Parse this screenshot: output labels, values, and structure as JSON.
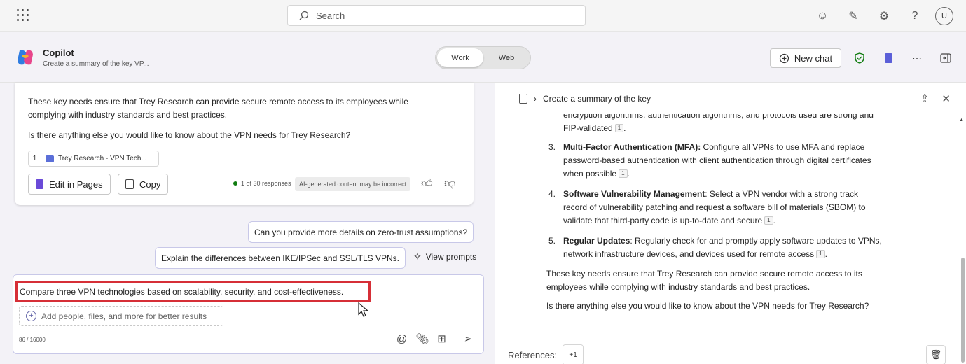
{
  "topbar": {
    "search_placeholder": "Search",
    "avatar_initial": "U"
  },
  "app": {
    "title": "Copilot",
    "subtitle": "Create a summary of the key VP...",
    "mode_work": "Work",
    "mode_web": "Web",
    "new_chat": "New chat"
  },
  "chat": {
    "answer_p1": "These key needs ensure that Trey Research can provide secure remote access to its employees while",
    "answer_p1b": "complying with industry standards and best practices.",
    "answer_p2": "Is there anything else you would like to know about the VPN needs for Trey Research?",
    "citation_num": "1",
    "citation_label": "Trey Research - VPN Tech...",
    "edit_in_pages": "Edit in Pages",
    "copy": "Copy",
    "responses": "1 of 30 responses",
    "ai_disclaimer": "AI-generated content may be incorrect",
    "suggestion_1": "Can you provide more details on zero-trust assumptions?",
    "suggestion_2": "Explain the differences between IKE/IPSec and SSL/TLS VPNs.",
    "view_prompts": "View prompts",
    "input_text": "Compare three VPN technologies based on scalability, security, and cost-effectiveness.",
    "add_placeholder": "Add people, files, and more for better results",
    "char_count": "86 / 16000"
  },
  "pane": {
    "title": "Create a summary of the key",
    "line_cut": "encryption algorithms, authentication algorithms, and protocols used are strong and",
    "line_fip": "FIP-validated",
    "item3_num": "3.",
    "item3_bold": "Multi-Factor Authentication (MFA):",
    "item3_l1": " Configure all VPNs to use MFA and replace",
    "item3_l2": "password-based authentication with client authentication through digital certificates",
    "item3_l3": "when possible",
    "item4_num": "4.",
    "item4_bold": "Software Vulnerability Management",
    "item4_l1": ": Select a VPN vendor with a strong track",
    "item4_l2": "record of vulnerability patching and request a software bill of materials (SBOM) to",
    "item4_l3": "validate that third-party code is up-to-date and secure",
    "item5_num": "5.",
    "item5_bold": "Regular Updates",
    "item5_l1": ": Regularly check for and promptly apply software updates to VPNs,",
    "item5_l2": "network infrastructure devices, and devices used for remote access",
    "summary_l1": "These key needs ensure that Trey Research can provide secure remote access to its",
    "summary_l2": "employees while complying with industry standards and best practices.",
    "question": "Is there anything else you would like to know about the VPN needs for Trey Research?",
    "ref_marker": "1",
    "references_label": "References:",
    "references_more": "+1"
  },
  "colors": {
    "accent": "#6264a7",
    "highlight_border": "#d62f37",
    "shield": "#107c10",
    "pages": "#6a4ad8"
  }
}
